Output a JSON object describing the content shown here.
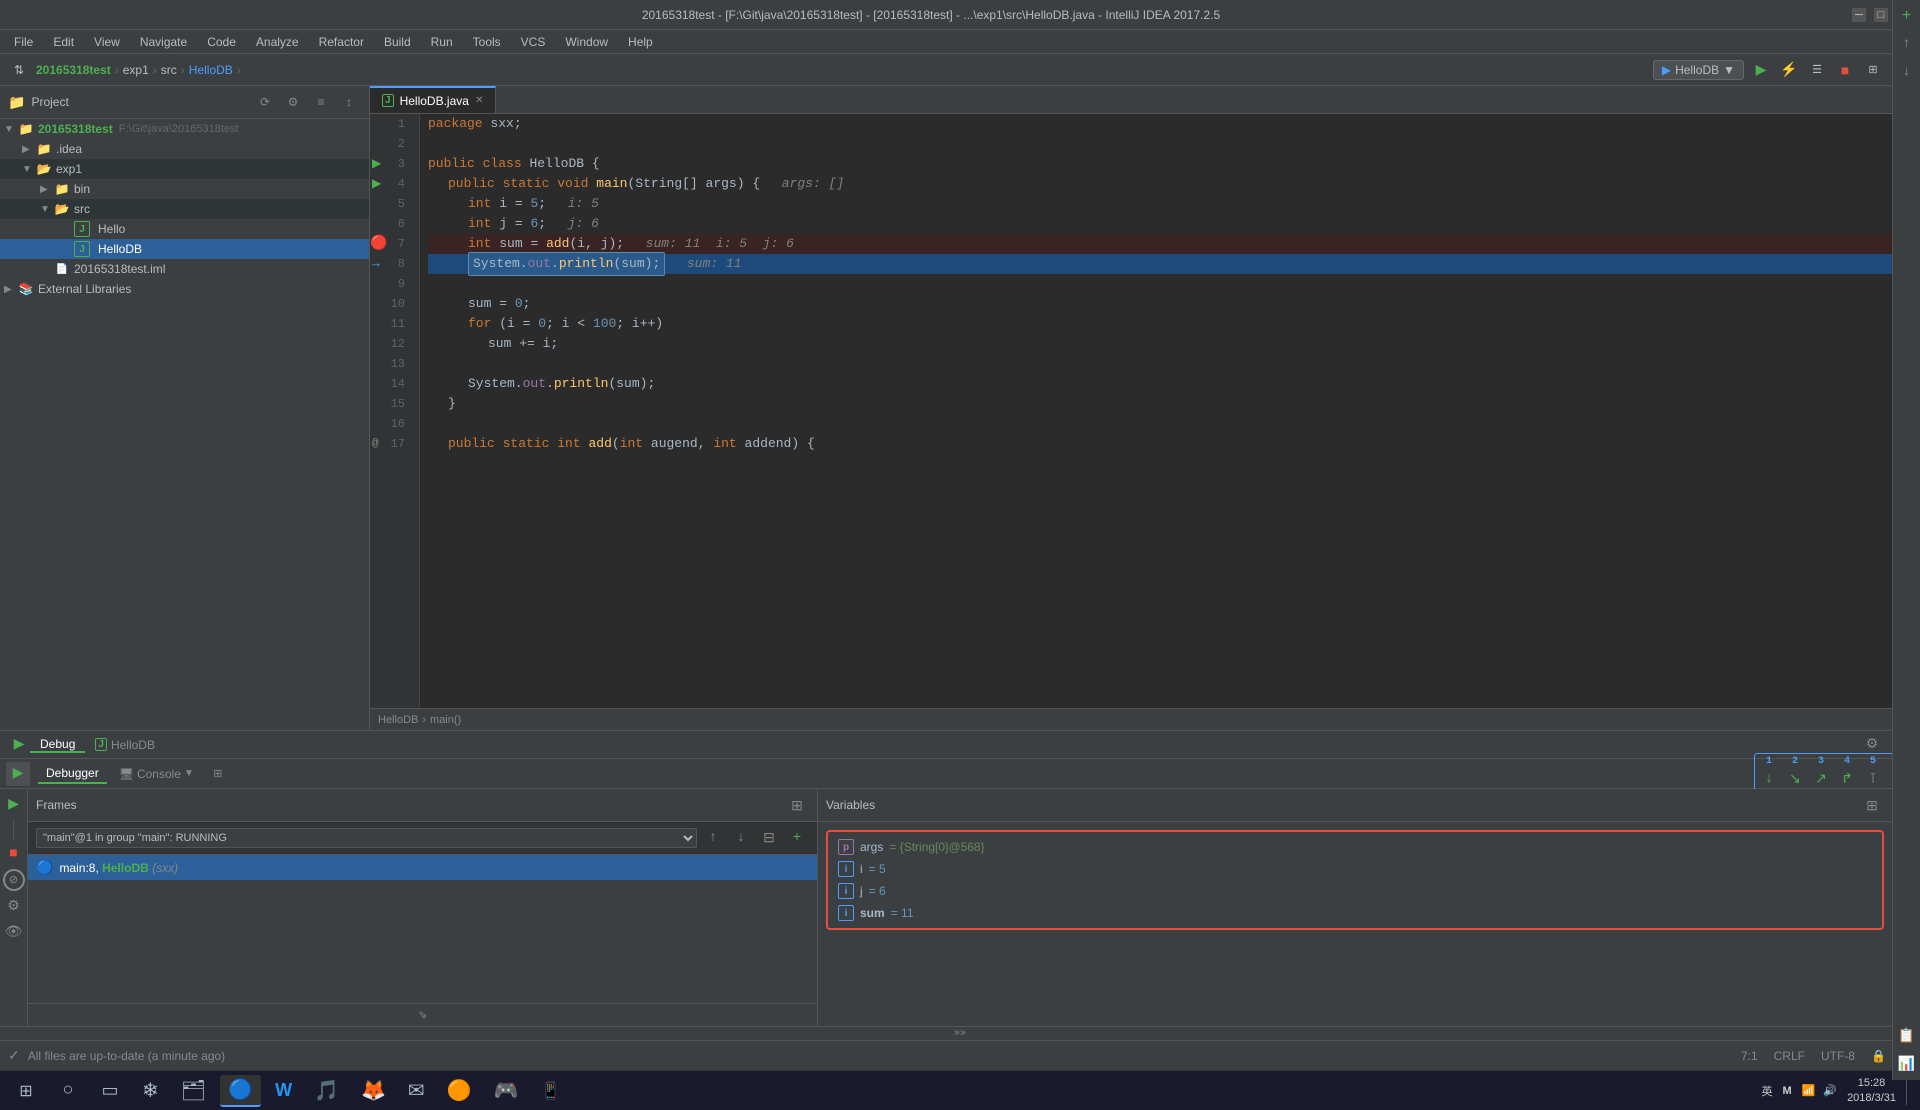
{
  "window": {
    "title": "20165318test - [F:\\Git\\java\\20165318test] - [20165318test] - ...\\exp1\\src\\HelloDB.java - IntelliJ IDEA 2017.2.5"
  },
  "menu": {
    "items": [
      "File",
      "Edit",
      "View",
      "Navigate",
      "Code",
      "Analyze",
      "Refactor",
      "Build",
      "Run",
      "Tools",
      "VCS",
      "Window",
      "Help"
    ]
  },
  "toolbar": {
    "breadcrumb": [
      "20165318test",
      "exp1",
      "src",
      "HelloDB"
    ],
    "run_config": "HelloDB",
    "buttons": [
      "▶",
      "⚡",
      "☰",
      "■",
      "⬛",
      "⊞",
      "🔍"
    ]
  },
  "sidebar": {
    "header": "Project",
    "tree": [
      {
        "level": 0,
        "label": "20165318test",
        "path": "F:\\Git\\java\\20165318test",
        "expanded": true,
        "type": "root"
      },
      {
        "level": 1,
        "label": ".idea",
        "expanded": false,
        "type": "folder"
      },
      {
        "level": 1,
        "label": "exp1",
        "expanded": true,
        "type": "folder"
      },
      {
        "level": 2,
        "label": "bin",
        "expanded": false,
        "type": "folder"
      },
      {
        "level": 2,
        "label": "src",
        "expanded": true,
        "type": "folder"
      },
      {
        "level": 3,
        "label": "Hello",
        "type": "java"
      },
      {
        "level": 3,
        "label": "HelloDB",
        "type": "java",
        "selected": true
      },
      {
        "level": 1,
        "label": "20165318test.iml",
        "type": "iml"
      },
      {
        "level": 0,
        "label": "External Libraries",
        "expanded": false,
        "type": "lib"
      }
    ]
  },
  "editor": {
    "tab": "HelloDB.java",
    "breadcrumb": [
      "HelloDB",
      "main()"
    ],
    "lines": [
      {
        "num": 1,
        "code": "package sxx;",
        "indent": 0
      },
      {
        "num": 2,
        "code": "",
        "indent": 0
      },
      {
        "num": 3,
        "code": "public class HelloDB {",
        "indent": 0,
        "gutter": "run"
      },
      {
        "num": 4,
        "code": "    public static void main(String[] args) {   args: []",
        "indent": 4,
        "gutter": "run"
      },
      {
        "num": 5,
        "code": "        int i = 5;   i: 5",
        "indent": 8
      },
      {
        "num": 6,
        "code": "        int j = 6;   j: 6",
        "indent": 8
      },
      {
        "num": 7,
        "code": "        int sum = add(i, j);   sum: 11  i: 5  j: 6",
        "indent": 8,
        "error": true
      },
      {
        "num": 8,
        "code": "        System.out.println(sum);   sum: 11",
        "indent": 8,
        "debug_current": true
      },
      {
        "num": 9,
        "code": "",
        "indent": 0
      },
      {
        "num": 10,
        "code": "        sum = 0;",
        "indent": 8
      },
      {
        "num": 11,
        "code": "        for (i = 0; i < 100; i++)",
        "indent": 8
      },
      {
        "num": 12,
        "code": "            sum += i;",
        "indent": 12
      },
      {
        "num": 13,
        "code": "",
        "indent": 0
      },
      {
        "num": 14,
        "code": "        System.out.println(sum);",
        "indent": 8
      },
      {
        "num": 15,
        "code": "    }",
        "indent": 4
      },
      {
        "num": 16,
        "code": "",
        "indent": 0
      },
      {
        "num": 17,
        "code": "    public static int add(int augend, int addend) {",
        "indent": 4,
        "gutter": "at"
      }
    ]
  },
  "debug": {
    "tabs": [
      "Debug",
      "HelloDB"
    ],
    "toolbar_nums": [
      "1",
      "2",
      "3",
      "4",
      "5"
    ],
    "toolbar_buttons": [
      "▼",
      "↓",
      "↘",
      "↗",
      "✕",
      "⊺",
      "▦"
    ],
    "frames_header": "Frames",
    "thread_label": "\"main\"@1 in group \"main\": RUNNING",
    "frames": [
      {
        "label": "main:8, HelloDB (sxx)",
        "selected": true
      }
    ],
    "variables_header": "Variables",
    "variables": [
      {
        "icon": "p",
        "name": "args",
        "value": "= {String[0]@568}"
      },
      {
        "icon": "i",
        "name": "i",
        "value": "= 5"
      },
      {
        "icon": "i",
        "name": "j",
        "value": "= 6"
      },
      {
        "icon": "i",
        "name": "sum",
        "value": "= 11"
      }
    ]
  },
  "status_bar": {
    "message": "All files are up-to-date (a minute ago)",
    "position": "7:1",
    "line_ending": "CRLF",
    "encoding": "UTF-8",
    "icons": [
      "🔒",
      "⊞"
    ]
  },
  "taskbar": {
    "apps": [
      "⊞",
      "○",
      "▭",
      "❄",
      "🗂",
      "🔵",
      "🟦",
      "W",
      "🎵",
      "🦊",
      "✉",
      "🟠",
      "🎮",
      "📱"
    ],
    "clock": "15:28",
    "date": "2018/3/31",
    "system_icons": [
      "英",
      "M"
    ]
  }
}
